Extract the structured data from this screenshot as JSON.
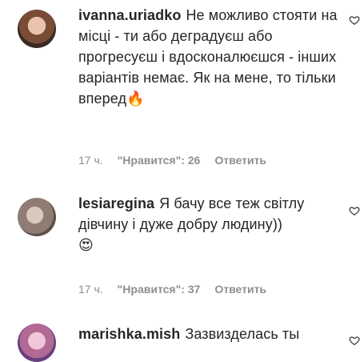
{
  "comments": [
    {
      "username": "ivanna.uriadko",
      "text": "Не можливо стояти на місці - ти або деградуєш або прогресуєш і вдосконалюєшся - інших варіантів немає. Як на мене, то тільки вперед",
      "emoji": "🔥",
      "time": "17 ч.",
      "likes": "\"Нравится\": 26",
      "reply": "Ответить"
    },
    {
      "username": "lesiaregina",
      "text": "Я бачу все теж світлу дівчину і дуже добру людину))",
      "emoji": "😍",
      "time": "17 ч.",
      "likes": "\"Нравится\": 37",
      "reply": "Ответить"
    },
    {
      "username": "marishka.mish",
      "text": "Зазвизделась ты",
      "emoji": "",
      "time": "",
      "likes": "",
      "reply": ""
    }
  ],
  "icons": {
    "like": "heart-outline-icon"
  },
  "colors": {
    "text": "#262626",
    "meta": "#8e8e8e"
  }
}
